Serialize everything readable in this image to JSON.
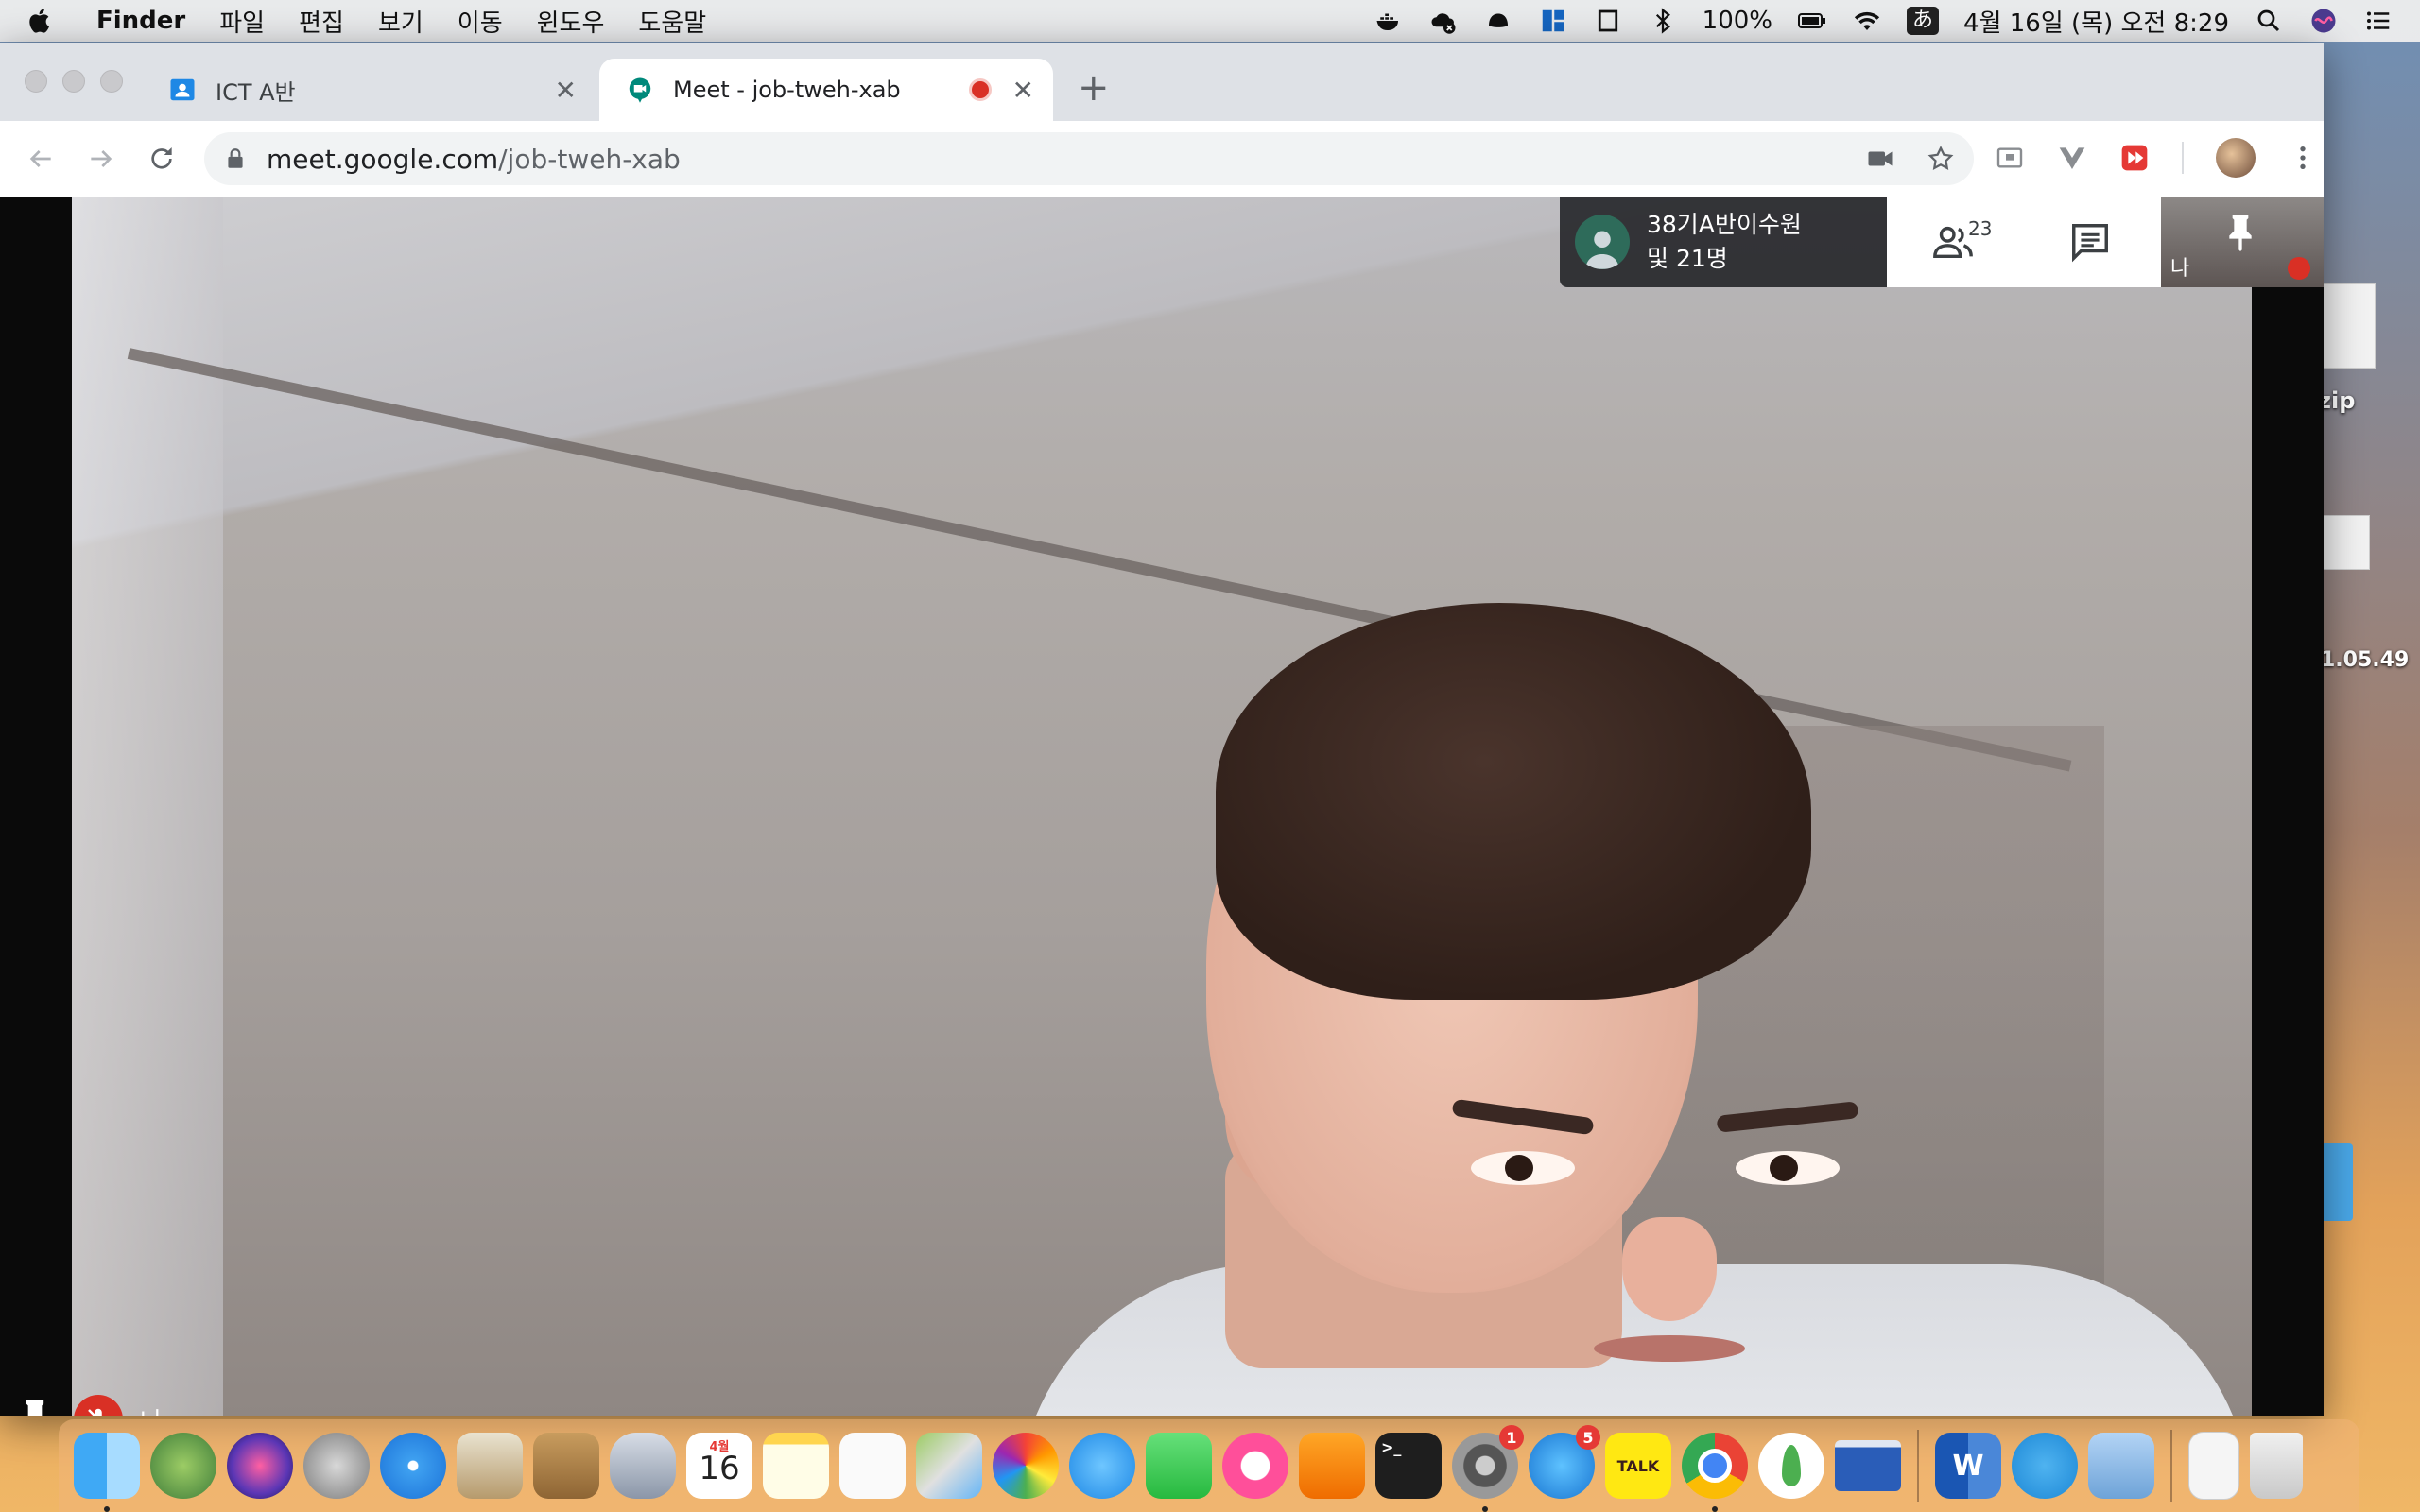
{
  "menubar": {
    "app_name": "Finder",
    "menus": [
      "파일",
      "편집",
      "보기",
      "이동",
      "윈도우",
      "도움말"
    ],
    "battery": "100%",
    "ime": "あ",
    "datetime": "4월 16일 (목) 오전  8:29"
  },
  "desktop": {
    "zip_label": "zip",
    "file_time_label": "1.05.49"
  },
  "browser": {
    "tabs": [
      {
        "label": "ICT A반",
        "favicon": "google-classroom-icon",
        "active": false
      },
      {
        "label": "Meet - job-tweh-xab",
        "favicon": "google-meet-icon",
        "active": true,
        "recording": true
      }
    ],
    "url_host": "meet.google.com",
    "url_path": "/job-tweh-xab"
  },
  "meet": {
    "participant_line1": "38기A반이수원",
    "participant_line2": "및 21명",
    "people_count": "23",
    "self_name": "나",
    "bottom_name": "나"
  },
  "dock": {
    "calendar_month": "4월",
    "calendar_day": "16",
    "sysprefs_badge": "1",
    "appstore_badge": "5",
    "kakao_label": "TALK",
    "word_label": "W",
    "apps": [
      "finder-icon",
      "android-studio-icon",
      "siri-icon",
      "launchpad-icon",
      "safari-icon",
      "mail-icon",
      "contacts-icon",
      "database-icon",
      "calendar-icon",
      "notes-icon",
      "reminders-icon",
      "maps-icon",
      "photos-icon",
      "messages-icon",
      "facetime-icon",
      "music-icon",
      "books-icon",
      "terminal-icon",
      "system-preferences-icon",
      "app-store-icon",
      "kakaotalk-icon",
      "chrome-icon",
      "mongodb-icon",
      "window-icon",
      "word-icon",
      "docker-icon",
      "preview-icon",
      "document-icon",
      "trash-icon"
    ]
  },
  "colors": {
    "meet_red": "#d93025",
    "chrome_tab_bg": "#dee1e6",
    "meet_green": "#2e6b5a"
  }
}
